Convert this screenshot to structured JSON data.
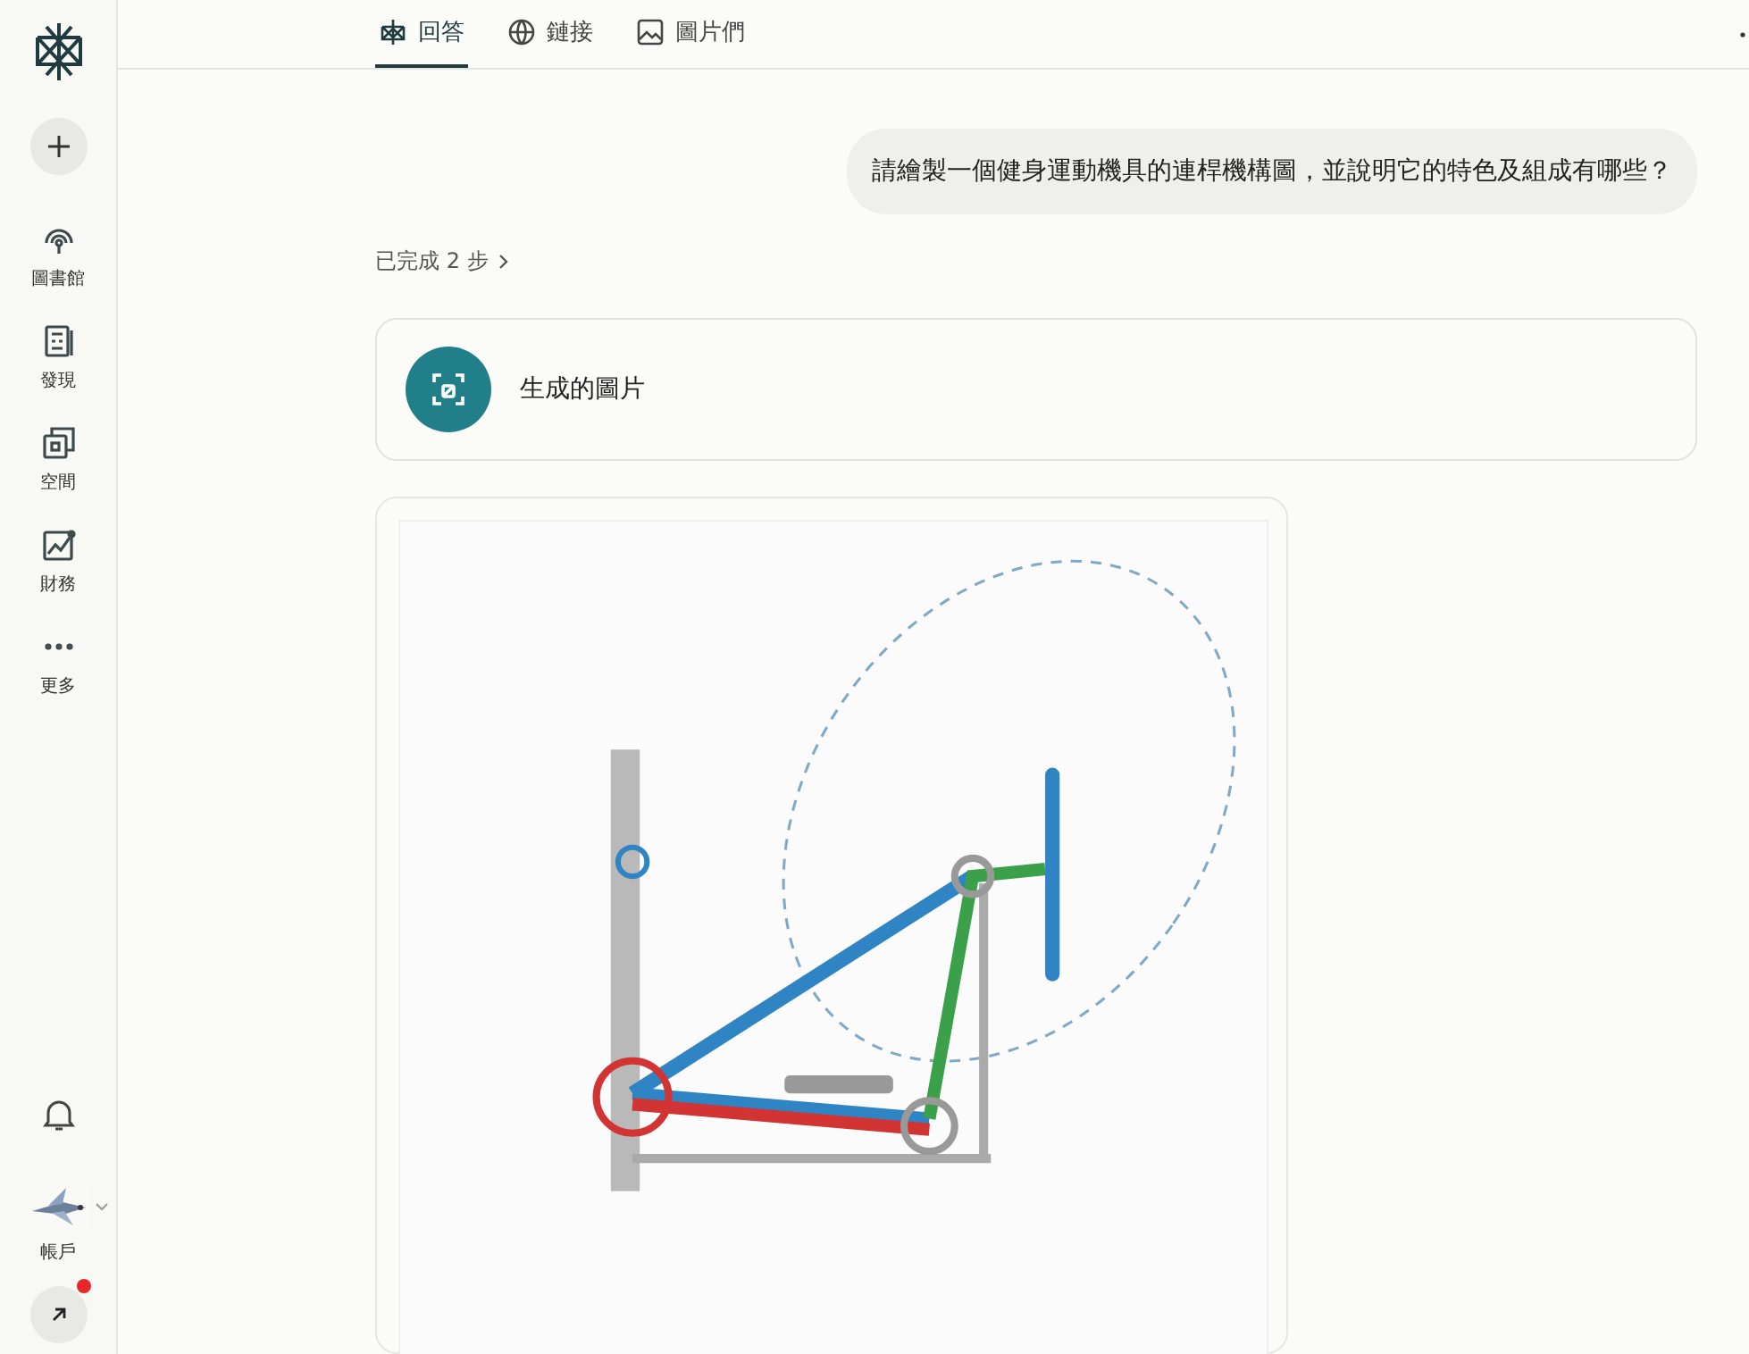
{
  "sidebar": {
    "items": [
      {
        "kind": "library",
        "label": "圖書館"
      },
      {
        "kind": "discover",
        "label": "發現"
      },
      {
        "kind": "spaces",
        "label": "空間"
      },
      {
        "kind": "finance",
        "label": "財務"
      },
      {
        "kind": "more",
        "label": "更多"
      }
    ],
    "account": {
      "label": "帳戶"
    },
    "notification_dot": true
  },
  "tabs": [
    {
      "kind": "answer",
      "label": "回答",
      "selected": true
    },
    {
      "kind": "links",
      "label": "鏈接",
      "selected": false
    },
    {
      "kind": "images",
      "label": "圖片們",
      "selected": false
    }
  ],
  "question": "請繪製一個健身運動機具的連桿機構圖，並說明它的特色及組成有哪些？",
  "steps": "已完成 2 步",
  "generated_card": {
    "label": "生成的圖片"
  }
}
